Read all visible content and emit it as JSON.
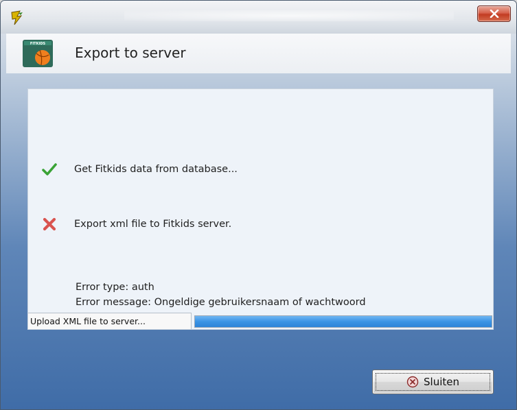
{
  "window": {
    "close_icon": "close-icon",
    "app_icon": "fitkids-app-icon"
  },
  "header": {
    "title": "Export to server",
    "logo_icon": "fitkids-logo-icon"
  },
  "tasks": [
    {
      "label": "Get Fitkids data from database...",
      "status": "success",
      "icon": "checkmark-icon",
      "color": "#3aa336"
    },
    {
      "label": "Export xml file to Fitkids server.",
      "status": "failed",
      "icon": "cross-icon",
      "color": "#d9534f"
    }
  ],
  "error": {
    "type_line": "Error type: auth",
    "message_line": "Error message: Ongeldige gebruikersnaam of wachtwoord"
  },
  "status": {
    "text": "Upload XML file to server...",
    "progress": 1.0,
    "progress_color": "#3b94e5"
  },
  "buttons": {
    "close_label": "Sluiten",
    "close_icon": "cancel-circle-icon"
  }
}
